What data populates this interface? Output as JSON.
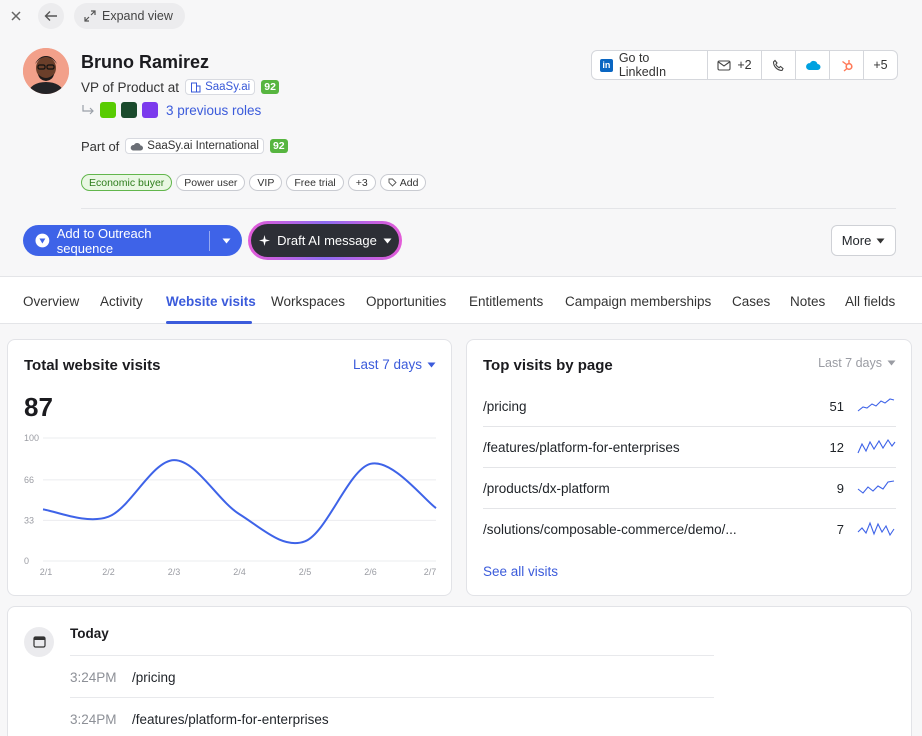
{
  "topbar": {
    "expand_label": "Expand view"
  },
  "person": {
    "name": "Bruno Ramirez",
    "title_prefix": "VP of Product at",
    "company": "SaaSy.ai",
    "company_score": "92",
    "previous_roles_label": "3 previous roles",
    "part_of_label": "Part of",
    "parent_company": "SaaSy.ai International",
    "parent_score": "92"
  },
  "tags": [
    "Economic buyer",
    "Power user",
    "VIP",
    "Free trial",
    "+3"
  ],
  "add_tag_label": "Add",
  "contact_actions": {
    "linkedin_label": "Go to LinkedIn",
    "email_count": "+2",
    "more_count": "+5"
  },
  "buttons": {
    "outreach_label": "Add to Outreach sequence",
    "draft_label": "Draft AI message",
    "more_label": "More"
  },
  "tabs": [
    "Overview",
    "Activity",
    "Website visits",
    "Workspaces",
    "Opportunities",
    "Entitlements",
    "Campaign memberships",
    "Cases",
    "Notes",
    "All fields"
  ],
  "active_tab": "Website visits",
  "total_visits": {
    "title": "Total website visits",
    "range": "Last 7 days",
    "total": "87"
  },
  "chart_data": {
    "type": "line",
    "x": [
      "2/1",
      "2/2",
      "2/3",
      "2/4",
      "2/5",
      "2/6",
      "2/7"
    ],
    "y": [
      42,
      36,
      82,
      38,
      16,
      79,
      43
    ],
    "yticks": [
      "100",
      "66",
      "33",
      "0"
    ],
    "ylim": [
      0,
      100
    ],
    "grid": true,
    "color": "#3e63e8"
  },
  "top_pages": {
    "title": "Top visits by page",
    "range": "Last 7 days",
    "rows": [
      {
        "page": "/pricing",
        "count": "51"
      },
      {
        "page": "/features/platform-for-enterprises",
        "count": "12"
      },
      {
        "page": "/products/dx-platform",
        "count": "9"
      },
      {
        "page": "/solutions/composable-commerce/demo/...",
        "count": "7"
      }
    ],
    "see_all_label": "See all visits"
  },
  "timeline": {
    "group_label": "Today",
    "visits": [
      {
        "time": "3:24PM",
        "url": "/pricing"
      },
      {
        "time": "3:24PM",
        "url": "/features/platform-for-enterprises"
      }
    ]
  },
  "colors": {
    "accent": "#3e63e8",
    "score_green": "#57b540",
    "draft_bg": "#2d2f36"
  }
}
